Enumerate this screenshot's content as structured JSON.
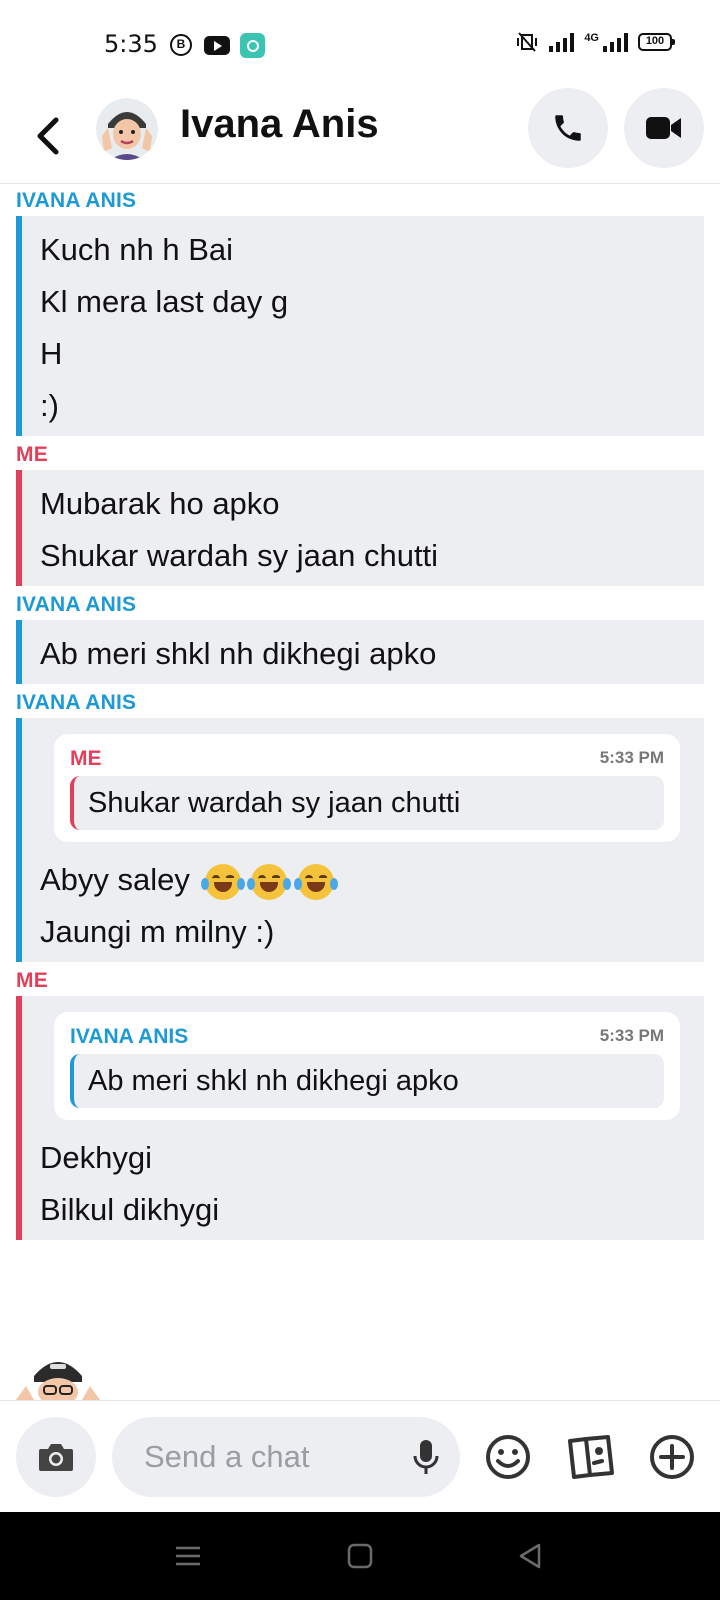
{
  "status_bar": {
    "time": "5:35",
    "b_icon_letter": "B",
    "network_label": "4G",
    "battery": "100"
  },
  "header": {
    "contact_name": "Ivana Anis"
  },
  "messages": [
    {
      "sender": "IVANA ANIS",
      "who": "them",
      "lines": [
        "Kuch nh h Bai",
        "Kl mera last day g",
        "H",
        ":)"
      ]
    },
    {
      "sender": "ME",
      "who": "me",
      "lines": [
        "Mubarak ho apko",
        "Shukar wardah sy jaan chutti"
      ]
    },
    {
      "sender": "IVANA ANIS",
      "who": "them",
      "lines": [
        "Ab meri shkl nh dikhegi apko"
      ]
    },
    {
      "sender": "IVANA ANIS",
      "who": "them",
      "quote": {
        "sender": "ME",
        "time": "5:33 PM",
        "text": "Shukar wardah sy jaan chutti"
      },
      "lines": [
        "Abyy saley",
        "Jaungi m milny :)"
      ]
    },
    {
      "sender": "ME",
      "who": "me",
      "quote": {
        "sender": "IVANA ANIS",
        "time": "5:33 PM",
        "text": "Ab meri shkl nh dikhegi apko"
      },
      "lines": [
        "Dekhygi",
        "Bilkul dikhygi"
      ]
    }
  ],
  "composer": {
    "placeholder": "Send a chat"
  },
  "icons": [
    "back-icon",
    "avatar",
    "phone-icon",
    "video-icon",
    "camera-icon",
    "mic-icon",
    "emoji-icon",
    "cards-icon",
    "plus-icon"
  ],
  "colors": {
    "them": "#1d9ad6",
    "me": "#e0405a",
    "bubble": "#eceef1"
  }
}
